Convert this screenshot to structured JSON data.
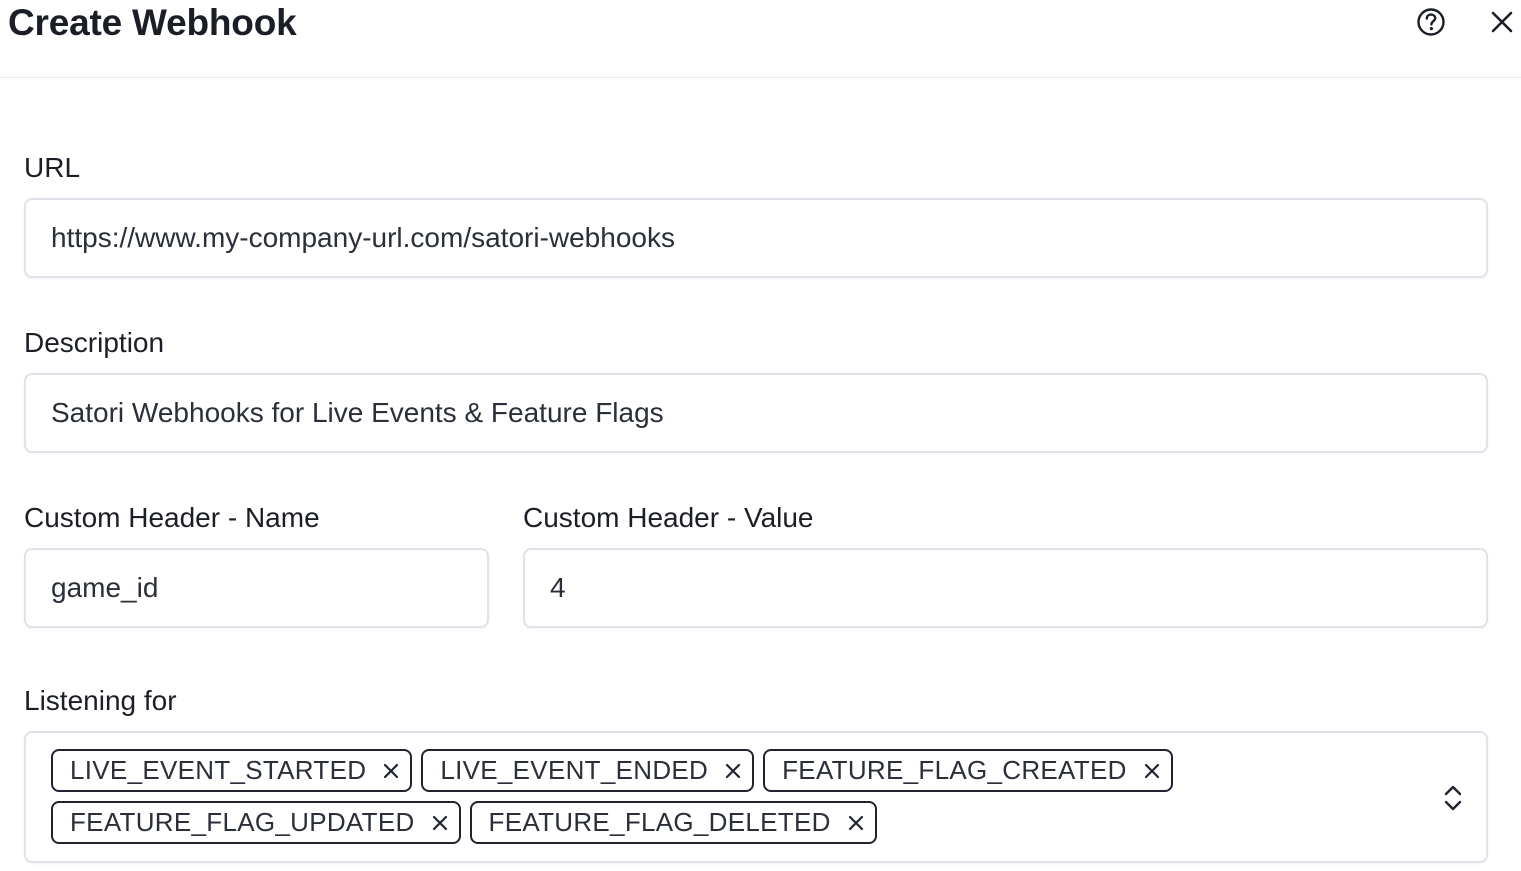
{
  "dialog": {
    "title": "Create Webhook",
    "help_icon": "question-circle-icon",
    "close_icon": "close-icon"
  },
  "form": {
    "url": {
      "label": "URL",
      "value": "https://www.my-company-url.com/satori-webhooks"
    },
    "description": {
      "label": "Description",
      "value": "Satori Webhooks for Live Events & Feature Flags"
    },
    "custom_header_name": {
      "label": "Custom Header - Name",
      "value": "game_id"
    },
    "custom_header_value": {
      "label": "Custom Header - Value",
      "value": "4"
    },
    "listening_for": {
      "label": "Listening for",
      "tags": [
        "LIVE_EVENT_STARTED",
        "LIVE_EVENT_ENDED",
        "FEATURE_FLAG_CREATED",
        "FEATURE_FLAG_UPDATED",
        "FEATURE_FLAG_DELETED"
      ],
      "tag_remove_icon": "x-icon",
      "dropdown_icon": "chevron-up-down-icon"
    }
  },
  "colors": {
    "text": "#1b1e27",
    "border": "#dfe2e8",
    "tag_border": "#1f2430",
    "divider": "#e6e8ec"
  }
}
